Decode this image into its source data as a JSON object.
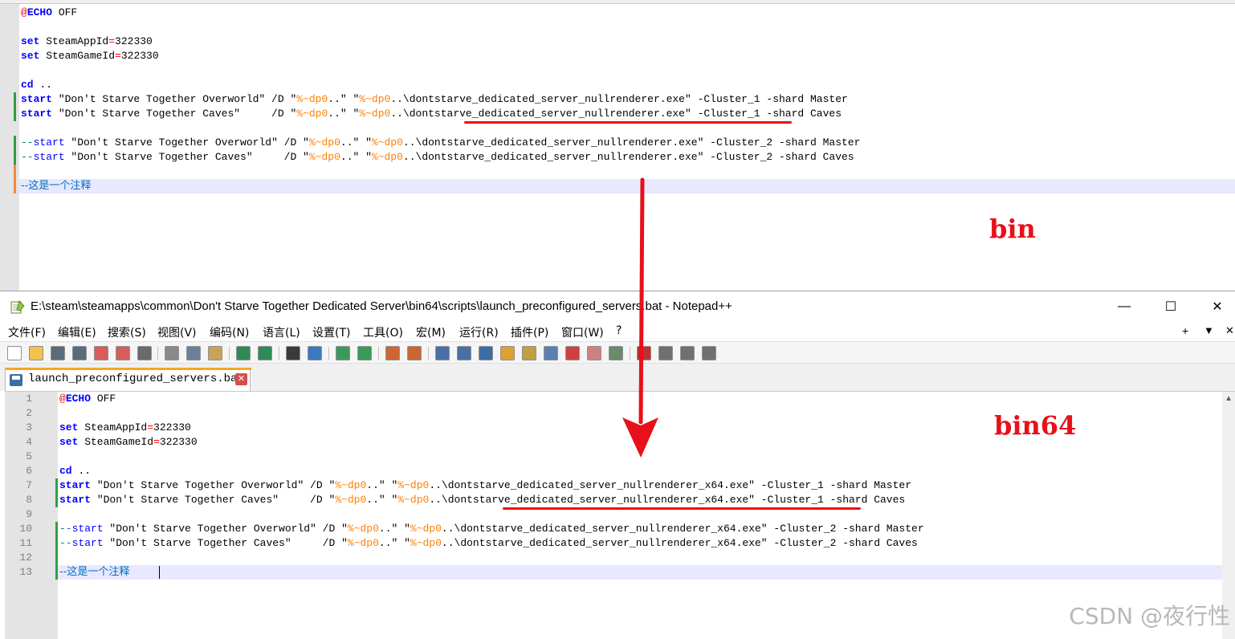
{
  "top_editor": {
    "lines": [
      {
        "parts": [
          [
            "op",
            "@"
          ],
          [
            "kw",
            "ECHO"
          ],
          [
            "plain",
            " OFF"
          ]
        ]
      },
      {
        "parts": []
      },
      {
        "parts": [
          [
            "kw",
            "set"
          ],
          [
            "plain",
            " SteamAppId"
          ],
          [
            "op",
            "="
          ],
          [
            "plain",
            "322330"
          ]
        ]
      },
      {
        "parts": [
          [
            "kw",
            "set"
          ],
          [
            "plain",
            " SteamGameId"
          ],
          [
            "op",
            "="
          ],
          [
            "plain",
            "322330"
          ]
        ]
      },
      {
        "parts": []
      },
      {
        "parts": [
          [
            "kw",
            "cd"
          ],
          [
            "plain",
            " .."
          ]
        ]
      },
      {
        "parts": [
          [
            "kw",
            "start"
          ],
          [
            "plain",
            " \"Don't Starve Together Overworld\" /D \""
          ],
          [
            "var",
            "%~dp0"
          ],
          [
            "plain",
            "..\" \""
          ],
          [
            "var",
            "%~dp0"
          ],
          [
            "plain",
            "..\\dontstarve_dedicated_server_nullrenderer.exe\" -Cluster_1 -shard Master"
          ]
        ]
      },
      {
        "parts": [
          [
            "kw",
            "start"
          ],
          [
            "plain",
            " \"Don't Starve Together Caves\"     /D \""
          ],
          [
            "var",
            "%~dp0"
          ],
          [
            "plain",
            "..\" \""
          ],
          [
            "var",
            "%~dp0"
          ],
          [
            "plain",
            "..\\dontstarve_dedicated_server_nullrenderer.exe\" -Cluster_1 -shard Caves"
          ]
        ]
      },
      {
        "parts": []
      },
      {
        "parts": [
          [
            "cmt",
            "--"
          ],
          [
            "kw2",
            "start"
          ],
          [
            "plain",
            " \"Don't Starve Together Overworld\" /D \""
          ],
          [
            "var",
            "%~dp0"
          ],
          [
            "plain",
            "..\" \""
          ],
          [
            "var",
            "%~dp0"
          ],
          [
            "plain",
            "..\\dontstarve_dedicated_server_nullrenderer.exe\" -Cluster_2 -shard Master"
          ]
        ]
      },
      {
        "parts": [
          [
            "cmt",
            "--"
          ],
          [
            "kw2",
            "start"
          ],
          [
            "plain",
            " \"Don't Starve Together Caves\"     /D \""
          ],
          [
            "var",
            "%~dp0"
          ],
          [
            "plain",
            "..\" \""
          ],
          [
            "var",
            "%~dp0"
          ],
          [
            "plain",
            "..\\dontstarve_dedicated_server_nullrenderer.exe\" -Cluster_2 -shard Caves"
          ]
        ]
      },
      {
        "parts": []
      },
      {
        "parts": [
          [
            "cmtcn",
            "--这是一个注释"
          ]
        ]
      }
    ]
  },
  "annotations": {
    "top_label": "bin",
    "bottom_label": "bin64",
    "accent_color": "#e8101a"
  },
  "window": {
    "title": "E:\\steam\\steamapps\\common\\Don't Starve Together Dedicated Server\\bin64\\scripts\\launch_preconfigured_servers.bat - Notepad++",
    "minimize": "—",
    "maximize": "☐",
    "close": "✕"
  },
  "menu": {
    "items": [
      "文件(F)",
      "编辑(E)",
      "搜索(S)",
      "视图(V)",
      "编码(N)",
      "语言(L)",
      "设置(T)",
      "工具(O)",
      "宏(M)",
      "运行(R)",
      "插件(P)",
      "窗口(W)",
      "?"
    ],
    "right_plus": "+",
    "right_down": "▼",
    "right_close": "✕"
  },
  "tab": {
    "label": "launch_preconfigured_servers.bat",
    "close": "✕"
  },
  "editor": {
    "line_numbers": [
      "1",
      "2",
      "3",
      "4",
      "5",
      "6",
      "7",
      "8",
      "9",
      "10",
      "11",
      "12",
      "13"
    ],
    "lines": [
      {
        "parts": [
          [
            "op",
            "@"
          ],
          [
            "kw",
            "ECHO"
          ],
          [
            "plain",
            " OFF"
          ]
        ]
      },
      {
        "parts": []
      },
      {
        "parts": [
          [
            "kw",
            "set"
          ],
          [
            "plain",
            " SteamAppId"
          ],
          [
            "op",
            "="
          ],
          [
            "plain",
            "322330"
          ]
        ]
      },
      {
        "parts": [
          [
            "kw",
            "set"
          ],
          [
            "plain",
            " SteamGameId"
          ],
          [
            "op",
            "="
          ],
          [
            "plain",
            "322330"
          ]
        ]
      },
      {
        "parts": []
      },
      {
        "parts": [
          [
            "kw",
            "cd"
          ],
          [
            "plain",
            " .."
          ]
        ]
      },
      {
        "parts": [
          [
            "kw",
            "start"
          ],
          [
            "plain",
            " \"Don't Starve Together Overworld\" /D \""
          ],
          [
            "var",
            "%~dp0"
          ],
          [
            "plain",
            "..\" \""
          ],
          [
            "var",
            "%~dp0"
          ],
          [
            "plain",
            "..\\dontstarve_dedicated_server_nullrenderer_x64.exe\" -Cluster_1 -shard Master"
          ]
        ]
      },
      {
        "parts": [
          [
            "kw",
            "start"
          ],
          [
            "plain",
            " \"Don't Starve Together Caves\"     /D \""
          ],
          [
            "var",
            "%~dp0"
          ],
          [
            "plain",
            "..\" \""
          ],
          [
            "var",
            "%~dp0"
          ],
          [
            "plain",
            "..\\dontstarve_dedicated_server_nullrenderer_x64.exe\" -Cluster_1 -shard Caves"
          ]
        ]
      },
      {
        "parts": []
      },
      {
        "parts": [
          [
            "cmt",
            "--"
          ],
          [
            "kw2",
            "start"
          ],
          [
            "plain",
            " \"Don't Starve Together Overworld\" /D \""
          ],
          [
            "var",
            "%~dp0"
          ],
          [
            "plain",
            "..\" \""
          ],
          [
            "var",
            "%~dp0"
          ],
          [
            "plain",
            "..\\dontstarve_dedicated_server_nullrenderer_x64.exe\" -Cluster_2 -shard Master"
          ]
        ]
      },
      {
        "parts": [
          [
            "cmt",
            "--"
          ],
          [
            "kw2",
            "start"
          ],
          [
            "plain",
            " \"Don't Starve Together Caves\"     /D \""
          ],
          [
            "var",
            "%~dp0"
          ],
          [
            "plain",
            "..\" \""
          ],
          [
            "var",
            "%~dp0"
          ],
          [
            "plain",
            "..\\dontstarve_dedicated_server_nullrenderer_x64.exe\" -Cluster_2 -shard Caves"
          ]
        ]
      },
      {
        "parts": []
      },
      {
        "parts": [
          [
            "cmtcn",
            "--这是一个注释"
          ]
        ]
      }
    ]
  },
  "toolbar_icons": [
    "new-file-icon",
    "open-file-icon",
    "save-icon",
    "save-all-icon",
    "close-icon",
    "close-all-icon",
    "print-icon",
    "cut-icon",
    "copy-icon",
    "paste-icon",
    "undo-icon",
    "redo-icon",
    "find-icon",
    "replace-icon",
    "zoom-in-icon",
    "zoom-out-icon",
    "sync-vertical-icon",
    "sync-horizontal-icon",
    "word-wrap-icon",
    "show-all-chars-icon",
    "indent-guide-icon",
    "lang-icon",
    "doc-map-icon",
    "function-list-icon",
    "folder-workspace-icon",
    "monitor-icon",
    "record-macro-icon",
    "stop-macro-icon",
    "play-macro-icon",
    "run-macro-multiple-icon",
    "save-macro-icon"
  ],
  "watermark": "CSDN @夜行性"
}
